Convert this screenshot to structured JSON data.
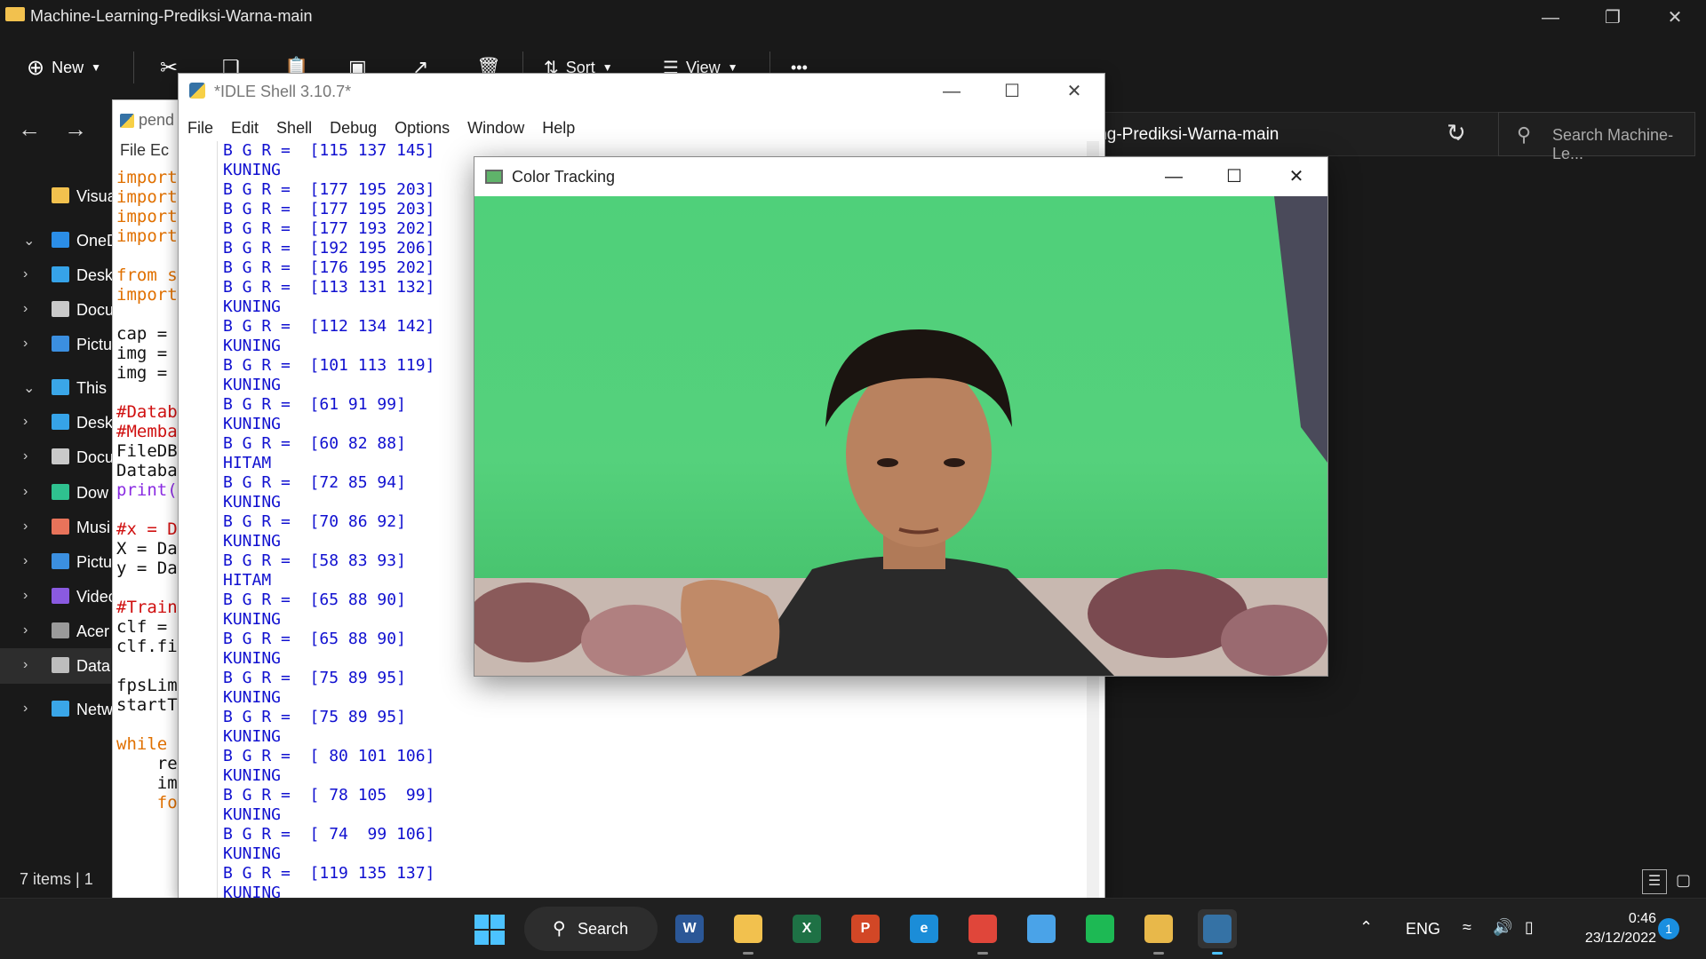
{
  "explorer": {
    "title": "Machine-Learning-Prediksi-Warna-main",
    "toolbar": {
      "new": "New",
      "sort": "Sort",
      "view": "View",
      "more": "•••"
    },
    "path": "ing-Prediksi-Warna-main",
    "search_placeholder": "Search Machine-Le...",
    "nav": [
      {
        "label": "Visua",
        "color": "#f2c14e",
        "expand": ""
      },
      {
        "label": "OneDr",
        "color": "#2b8de6",
        "expand": "⌄"
      },
      {
        "label": "Desk",
        "color": "#36a3e8",
        "expand": "›"
      },
      {
        "label": "Docu",
        "color": "#c9c9c9",
        "expand": "›"
      },
      {
        "label": "Pictu",
        "color": "#3b8fe0",
        "expand": "›"
      },
      {
        "label": "This P",
        "color": "#3aa6e8",
        "expand": "⌄"
      },
      {
        "label": "Desk",
        "color": "#36a3e8",
        "expand": "›"
      },
      {
        "label": "Docu",
        "color": "#c9c9c9",
        "expand": "›"
      },
      {
        "label": "Dow",
        "color": "#2fc18f",
        "expand": "›"
      },
      {
        "label": "Musi",
        "color": "#e8735a",
        "expand": "›"
      },
      {
        "label": "Pictu",
        "color": "#3b8fe0",
        "expand": "›"
      },
      {
        "label": "Video",
        "color": "#8a5ae0",
        "expand": "›"
      },
      {
        "label": "Acer",
        "color": "#9a9a9a",
        "expand": "›"
      },
      {
        "label": "Data",
        "color": "#bdbdbd",
        "expand": "›"
      },
      {
        "label": "Netwo",
        "color": "#3aa6e8",
        "expand": "›"
      }
    ],
    "status": "7 items  |  1"
  },
  "editor": {
    "title": "pend",
    "menu": "File   Ec",
    "code": [
      {
        "t": "import",
        "c": "#e07000"
      },
      {
        "t": "import",
        "c": "#e07000"
      },
      {
        "t": "import",
        "c": "#e07000"
      },
      {
        "t": "import",
        "c": "#e07000"
      },
      {
        "t": "",
        "c": "#111"
      },
      {
        "t": "from s",
        "c": "#e07000"
      },
      {
        "t": "import",
        "c": "#e07000"
      },
      {
        "t": "",
        "c": "#111"
      },
      {
        "t": "cap =",
        "c": "#111"
      },
      {
        "t": "img =",
        "c": "#111"
      },
      {
        "t": "img =",
        "c": "#111"
      },
      {
        "t": "",
        "c": "#111"
      },
      {
        "t": "#Datab",
        "c": "#d01010"
      },
      {
        "t": "#Memba",
        "c": "#d01010"
      },
      {
        "t": "FileDB",
        "c": "#111"
      },
      {
        "t": "Databa",
        "c": "#111"
      },
      {
        "t": "print(",
        "c": "#8a2be2"
      },
      {
        "t": "",
        "c": "#111"
      },
      {
        "t": "#x = D",
        "c": "#d01010"
      },
      {
        "t": "X = Da",
        "c": "#111"
      },
      {
        "t": "y = Da",
        "c": "#111"
      },
      {
        "t": "",
        "c": "#111"
      },
      {
        "t": "#Train",
        "c": "#d01010"
      },
      {
        "t": "clf =",
        "c": "#111"
      },
      {
        "t": "clf.fi",
        "c": "#111"
      },
      {
        "t": "",
        "c": "#111"
      },
      {
        "t": "fpsLim",
        "c": "#111"
      },
      {
        "t": "startT",
        "c": "#111"
      },
      {
        "t": "",
        "c": "#111"
      },
      {
        "t": "while",
        "c": "#e07000"
      },
      {
        "t": "    re",
        "c": "#111"
      },
      {
        "t": "    im",
        "c": "#111"
      },
      {
        "t": "    fo",
        "c": "#e07000"
      }
    ]
  },
  "idle": {
    "title": "*IDLE Shell 3.10.7*",
    "menu": [
      "File",
      "Edit",
      "Shell",
      "Debug",
      "Options",
      "Window",
      "Help"
    ],
    "lines": [
      "B G R =  [115 137 145]",
      "KUNING",
      "B G R =  [177 195 203]",
      "B G R =  [177 195 203]",
      "B G R =  [177 193 202]",
      "B G R =  [192 195 206]",
      "B G R =  [176 195 202]",
      "B G R =  [113 131 132]",
      "KUNING",
      "B G R =  [112 134 142]",
      "KUNING",
      "B G R =  [101 113 119]",
      "KUNING",
      "B G R =  [61 91 99]",
      "KUNING",
      "B G R =  [60 82 88]",
      "HITAM",
      "B G R =  [72 85 94]",
      "KUNING",
      "B G R =  [70 86 92]",
      "KUNING",
      "B G R =  [58 83 93]",
      "HITAM",
      "B G R =  [65 88 90]",
      "KUNING",
      "B G R =  [65 88 90]",
      "KUNING",
      "B G R =  [75 89 95]",
      "KUNING",
      "B G R =  [75 89 95]",
      "KUNING",
      "B G R =  [ 80 101 106]",
      "KUNING",
      "B G R =  [ 78 105  99]",
      "KUNING",
      "B G R =  [ 74  99 106]",
      "KUNING",
      "B G R =  [119 135 137]",
      "KUNING"
    ]
  },
  "color_tracking": {
    "title": "Color Tracking"
  },
  "taskbar": {
    "search_label": "Search",
    "apps": [
      {
        "name": "word-app",
        "label": "W",
        "color": "#2b5797"
      },
      {
        "name": "file-explorer-app",
        "label": "",
        "color": "#f2c14e"
      },
      {
        "name": "excel-app",
        "label": "X",
        "color": "#1e7145"
      },
      {
        "name": "powerpoint-app",
        "label": "P",
        "color": "#d24726"
      },
      {
        "name": "edge-app",
        "label": "e",
        "color": "#1b8dd8"
      },
      {
        "name": "chrome-app",
        "label": "",
        "color": "#e0463a"
      },
      {
        "name": "notepad-app",
        "label": "",
        "color": "#4aa3e8"
      },
      {
        "name": "spotify-app",
        "label": "",
        "color": "#1db954"
      },
      {
        "name": "paint-app",
        "label": "",
        "color": "#e8b84a"
      },
      {
        "name": "python-idle-app",
        "label": "",
        "color": "#3572a5"
      }
    ],
    "lang": "ENG",
    "time": "0:46",
    "date": "23/12/2022",
    "notifications": "1"
  }
}
